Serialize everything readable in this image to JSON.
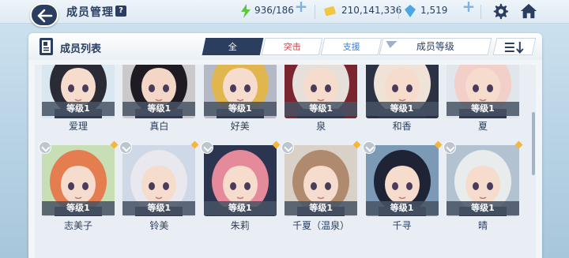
{
  "header": {
    "title": "成员管理",
    "help": "?",
    "resources": {
      "ap": "936/186",
      "credits": "210,141,336",
      "gems": "1,519"
    }
  },
  "panel": {
    "title": "成员列表",
    "filters": [
      "全",
      "突击",
      "支援"
    ],
    "active_filter": "全",
    "sort_label": "成员等级"
  },
  "members": [
    {
      "name": "爱理",
      "level": "等级1",
      "hair": "#2a2b34",
      "bg": "#d9e8f0",
      "skin": "#f6dccc"
    },
    {
      "name": "真白",
      "level": "等级1",
      "hair": "#1e1c22",
      "bg": "#cbc9c9",
      "skin": "#f4d6c6"
    },
    {
      "name": "好美",
      "level": "等级1",
      "hair": "#e2b64f",
      "bg": "#b4b9c5",
      "skin": "#f6dccc"
    },
    {
      "name": "泉",
      "level": "等级1",
      "hair": "#e7e0da",
      "bg": "#7a2630",
      "skin": "#f6dccc"
    },
    {
      "name": "和香",
      "level": "等级1",
      "hair": "#efe2d6",
      "bg": "#2a3244",
      "skin": "#f6dccc"
    },
    {
      "name": "夏",
      "level": "等级1",
      "hair": "#f2cfc8",
      "bg": "#e1e6ed",
      "skin": "#f6dccc"
    },
    {
      "name": "志美子",
      "level": "等级1",
      "hair": "#e47d4f",
      "bg": "#c8dfb5",
      "skin": "#f6dccc"
    },
    {
      "name": "铃美",
      "level": "等级1",
      "hair": "#e8e8ee",
      "bg": "#cfd8e6",
      "skin": "#f6dccc"
    },
    {
      "name": "朱莉",
      "level": "等级1",
      "hair": "#e48a9a",
      "bg": "#2b3550",
      "skin": "#f6dccc"
    },
    {
      "name": "千夏（温泉）",
      "level": "等级1",
      "hair": "#b08a6e",
      "bg": "#d9d1c7",
      "skin": "#f6dccc"
    },
    {
      "name": "千寻",
      "level": "等级1",
      "hair": "#1e2435",
      "bg": "#7c9ab5",
      "skin": "#f6dccc"
    },
    {
      "name": "晴",
      "level": "等级1",
      "hair": "#e9ecec",
      "bg": "#b3c2d1",
      "skin": "#f6dccc"
    }
  ],
  "colors": {
    "navy": "#2b3e60",
    "accent_star": "#f6b63a",
    "striker": "#d9434f",
    "special": "#3a7fd6"
  }
}
